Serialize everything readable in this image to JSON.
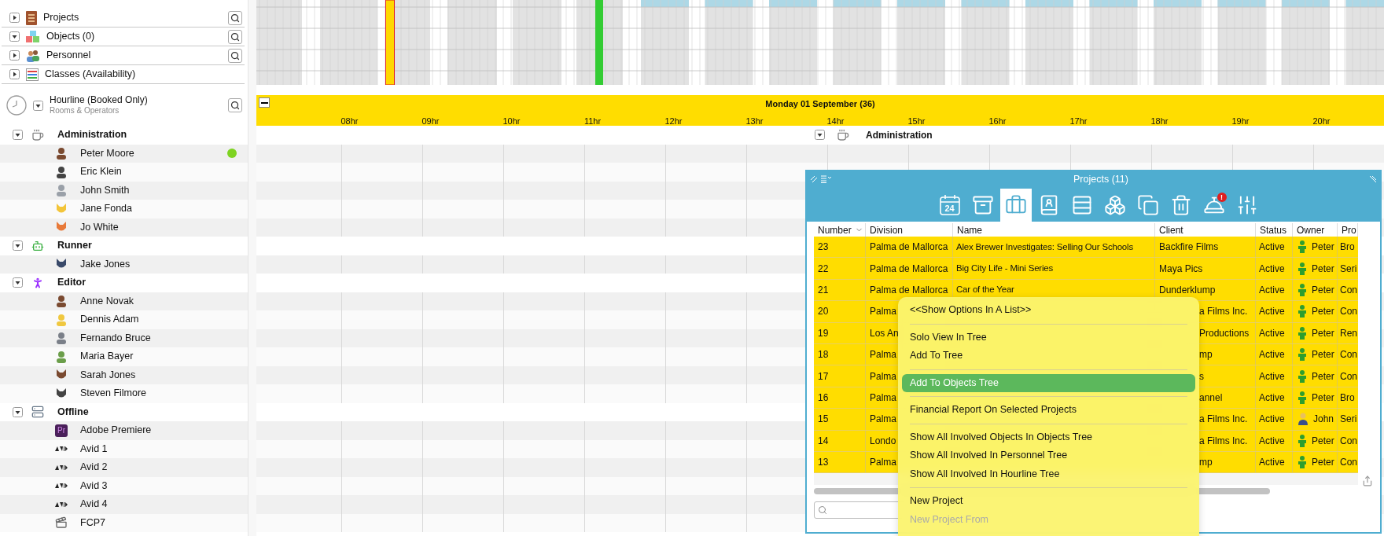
{
  "sections": [
    {
      "label": "Projects",
      "expanded": false,
      "kind": "cabinet",
      "search": true
    },
    {
      "label": "Objects (0)",
      "expanded": true,
      "kind": "cubes",
      "search": true
    },
    {
      "label": "Personnel",
      "expanded": false,
      "kind": "people",
      "search": true
    },
    {
      "label": "Classes (Availability)",
      "expanded": false,
      "kind": "classes",
      "search": false
    }
  ],
  "hourline": {
    "title": "Hourline (Booked Only)",
    "subtitle": "Rooms & Operators",
    "expanded": true
  },
  "tree": [
    {
      "label": "Administration",
      "kind": "cup",
      "expanded": true,
      "children": [
        {
          "label": "Peter Moore",
          "kind": "person",
          "color": "#7ed321"
        },
        {
          "label": "Eric Klein",
          "kind": "person"
        },
        {
          "label": "John Smith",
          "kind": "person"
        },
        {
          "label": "Jane Fonda",
          "kind": "animal"
        },
        {
          "label": "Jo White",
          "kind": "animal"
        }
      ]
    },
    {
      "label": "Runner",
      "kind": "robot",
      "expanded": true,
      "children": [
        {
          "label": "Jake Jones",
          "kind": "animal"
        }
      ]
    },
    {
      "label": "Editor",
      "kind": "figure",
      "expanded": true,
      "children": [
        {
          "label": "Anne Novak",
          "kind": "person"
        },
        {
          "label": "Dennis Adam",
          "kind": "person"
        },
        {
          "label": "Fernando Bruce",
          "kind": "person"
        },
        {
          "label": "Maria Bayer",
          "kind": "person"
        },
        {
          "label": "Sarah Jones",
          "kind": "animal"
        },
        {
          "label": "Steven Filmore",
          "kind": "animal"
        }
      ]
    },
    {
      "label": "Offline",
      "kind": "server",
      "expanded": true,
      "children": [
        {
          "label": "Adobe Premiere",
          "kind": "app",
          "badge": "Pr"
        },
        {
          "label": "Avid 1",
          "kind": "avid"
        },
        {
          "label": "Avid 2",
          "kind": "avid"
        },
        {
          "label": "Avid 3",
          "kind": "avid"
        },
        {
          "label": "Avid 4",
          "kind": "avid"
        },
        {
          "label": "FCP7",
          "kind": "clapper"
        }
      ]
    }
  ],
  "timeline": {
    "date": "Monday 01 September (36)",
    "hours": [
      "08hr",
      "09hr",
      "10hr",
      "11hr",
      "12hr",
      "13hr",
      "14hr",
      "15hr",
      "16hr",
      "17hr",
      "18hr",
      "19hr",
      "20hr"
    ],
    "group_label": "Administration",
    "group_expanded": true
  },
  "projects_window": {
    "title": "Projects (11)",
    "toolbar": [
      {
        "kind": "calendar",
        "label": "24",
        "selected": false
      },
      {
        "kind": "archive",
        "selected": false
      },
      {
        "kind": "briefcase",
        "selected": true
      },
      {
        "kind": "contacts",
        "selected": false
      },
      {
        "kind": "list",
        "selected": false
      },
      {
        "kind": "blocks",
        "selected": false
      },
      {
        "kind": "copy",
        "selected": false
      },
      {
        "kind": "trash",
        "selected": false
      },
      {
        "kind": "bell",
        "alert": "!",
        "selected": false
      },
      {
        "kind": "sliders",
        "selected": false
      }
    ],
    "columns": [
      {
        "label": "Number",
        "sorted": true
      },
      {
        "label": "Division",
        "sorted": false
      },
      {
        "label": "Name",
        "sorted": false
      },
      {
        "label": "Client",
        "sorted": false
      },
      {
        "label": "Status",
        "sorted": false
      },
      {
        "label": "Owner",
        "sorted": false
      },
      {
        "label": "Pro",
        "sorted": false
      }
    ],
    "rows": [
      {
        "kind": "staff",
        "number": "23",
        "division": "Palma de Mallorca",
        "name": "Alex Brewer Investigates: Selling Our Schools",
        "client": "Backfire Films",
        "status": "Active",
        "owner": "Peter",
        "pro": "Bro",
        "covered": false
      },
      {
        "kind": "staff",
        "number": "22",
        "division": "Palma de Mallorca",
        "name": "Big City Life - Mini Series",
        "client": "Maya Pics",
        "status": "Active",
        "owner": "Peter",
        "pro": "Seri",
        "covered": false
      },
      {
        "kind": "staff",
        "number": "21",
        "division": "Palma de Mallorca",
        "name": "Car of the Year",
        "client": "Dunderklump",
        "status": "Active",
        "owner": "Peter",
        "pro": "Con",
        "covered": false
      },
      {
        "kind": "staff",
        "number": "20",
        "division": "Palma",
        "client": "a Films Inc.",
        "status": "Active",
        "owner": "Peter",
        "pro": "Con",
        "covered": true
      },
      {
        "kind": "staff",
        "number": "19",
        "division": "Los An",
        "client": "Productions",
        "status": "Active",
        "owner": "Peter",
        "pro": "Ren",
        "covered": true
      },
      {
        "kind": "staff",
        "number": "18",
        "division": "Palma",
        "client": "mp",
        "status": "Active",
        "owner": "Peter",
        "pro": "Con",
        "covered": true
      },
      {
        "kind": "staff",
        "number": "17",
        "division": "Palma",
        "client": "s",
        "status": "Active",
        "owner": "Peter",
        "pro": "Con",
        "covered": true
      },
      {
        "kind": "staff",
        "number": "16",
        "division": "Palma",
        "client": "annel",
        "status": "Active",
        "owner": "Peter",
        "pro": "Bro",
        "covered": true
      },
      {
        "kind": "manager",
        "number": "15",
        "division": "Palma",
        "client": "a Films Inc.",
        "status": "Active",
        "owner": "John",
        "pro": "Seri",
        "covered": true
      },
      {
        "kind": "staff",
        "number": "14",
        "division": "Londo",
        "client": "a Films Inc.",
        "status": "Active",
        "owner": "Peter",
        "pro": "Con",
        "covered": true
      },
      {
        "kind": "staff",
        "number": "13",
        "division": "Palma",
        "client": "mp",
        "status": "Active",
        "owner": "Peter",
        "pro": "Con",
        "covered": true
      }
    ]
  },
  "context_menu": [
    {
      "kind": "item",
      "label": "<<Show Options In A List>>",
      "selected": false,
      "disabled": false
    },
    {
      "kind": "separator"
    },
    {
      "kind": "item",
      "label": "Solo View In Tree",
      "selected": false,
      "disabled": false
    },
    {
      "kind": "item",
      "label": "Add To Tree",
      "selected": false,
      "disabled": false
    },
    {
      "kind": "separator"
    },
    {
      "kind": "item",
      "label": "Add To Objects Tree",
      "selected": true,
      "disabled": false
    },
    {
      "kind": "separator"
    },
    {
      "kind": "item",
      "label": "Financial Report On Selected Projects",
      "selected": false,
      "disabled": false
    },
    {
      "kind": "separator"
    },
    {
      "kind": "item",
      "label": "Show All Involved Objects In Objects Tree",
      "selected": false,
      "disabled": false
    },
    {
      "kind": "item",
      "label": "Show All Involved In Personnel Tree",
      "selected": false,
      "disabled": false
    },
    {
      "kind": "item",
      "label": "Show All Involved In Hourline Tree",
      "selected": false,
      "disabled": false
    },
    {
      "kind": "separator"
    },
    {
      "kind": "item",
      "label": "New Project",
      "selected": false,
      "disabled": false
    },
    {
      "kind": "item",
      "label": "New Project From",
      "selected": false,
      "disabled": true
    }
  ]
}
